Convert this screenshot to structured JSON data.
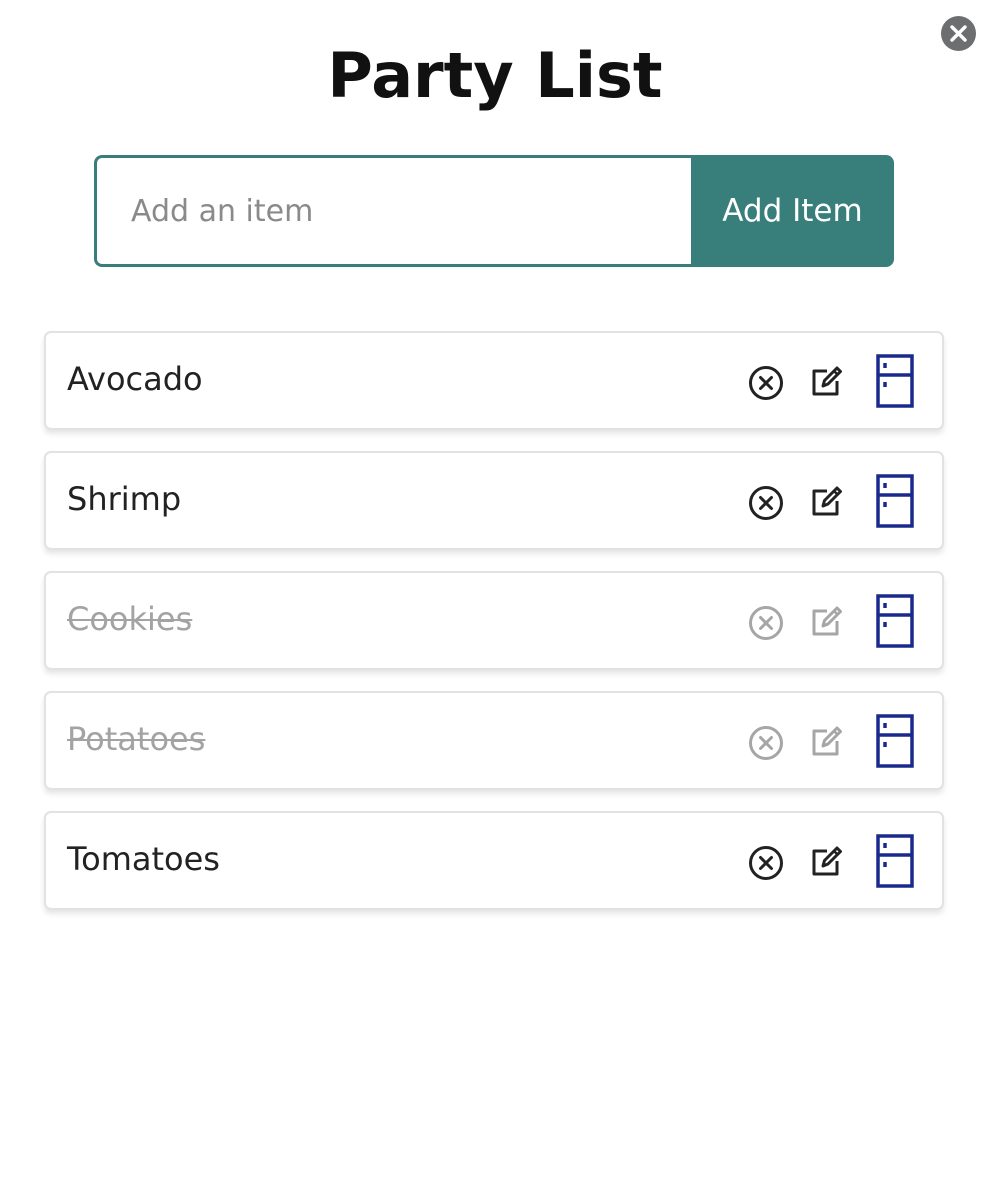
{
  "header": {
    "title": "Party List"
  },
  "add_form": {
    "placeholder": "Add an item",
    "value": "",
    "button_label": "Add Item"
  },
  "colors": {
    "accent": "#387f7c",
    "fridge_icon": "#1a2a8c",
    "completed_text": "#a3a3a3"
  },
  "items": [
    {
      "label": "Avocado",
      "completed": false
    },
    {
      "label": "Shrimp",
      "completed": false
    },
    {
      "label": "Cookies",
      "completed": true
    },
    {
      "label": "Potatoes",
      "completed": true
    },
    {
      "label": "Tomatoes",
      "completed": false
    }
  ],
  "icons": {
    "close": "close-icon",
    "remove": "remove-circle-x-icon",
    "edit": "edit-pencil-icon",
    "fridge": "fridge-icon"
  }
}
